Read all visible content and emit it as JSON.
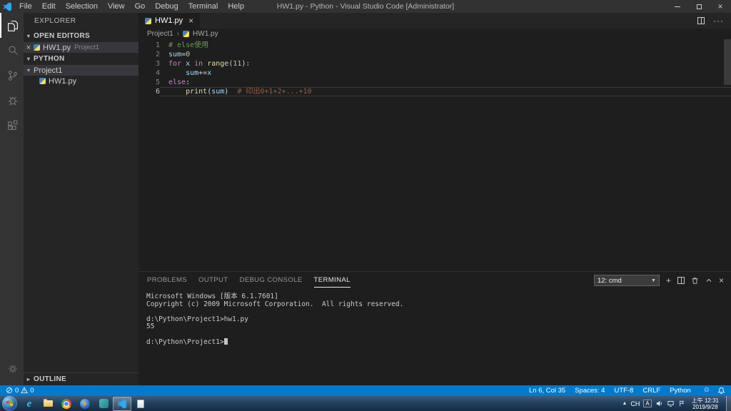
{
  "title_bar": {
    "app_title": "HW1.py - Python - Visual Studio Code [Administrator]",
    "menus": [
      "File",
      "Edit",
      "Selection",
      "View",
      "Go",
      "Debug",
      "Terminal",
      "Help"
    ]
  },
  "activity_bar": {
    "icons": [
      "files",
      "search",
      "source-control",
      "debug",
      "extensions",
      "settings-gear"
    ]
  },
  "sidebar": {
    "title": "EXPLORER",
    "open_editors": {
      "label": "OPEN EDITORS",
      "item": {
        "file": "HW1.py",
        "project": "Project1"
      }
    },
    "workspace": {
      "label": "PYTHON",
      "folder": "Project1",
      "file": "HW1.py"
    },
    "outline": {
      "label": "OUTLINE"
    }
  },
  "editor": {
    "tab": "HW1.py",
    "breadcrumb": [
      "Project1",
      "HW1.py"
    ],
    "current_line": 6,
    "lines": [
      {
        "num": "1",
        "tokens": [
          {
            "t": "# else使用",
            "c": "#6A9955"
          }
        ]
      },
      {
        "num": "2",
        "tokens": [
          {
            "t": "sum",
            "c": "#9CDCFE"
          },
          {
            "t": "=",
            "c": "#D4D4D4"
          },
          {
            "t": "0",
            "c": "#B5CEA8"
          }
        ]
      },
      {
        "num": "3",
        "tokens": [
          {
            "t": "for ",
            "c": "#C586C0"
          },
          {
            "t": "x ",
            "c": "#9CDCFE"
          },
          {
            "t": "in ",
            "c": "#C586C0"
          },
          {
            "t": "range",
            "c": "#DCDCAA"
          },
          {
            "t": "(",
            "c": "#D4D4D4"
          },
          {
            "t": "11",
            "c": "#B5CEA8"
          },
          {
            "t": "):",
            "c": "#D4D4D4"
          }
        ]
      },
      {
        "num": "4",
        "tokens": [
          {
            "t": "    sum",
            "c": "#9CDCFE"
          },
          {
            "t": "+=",
            "c": "#D4D4D4"
          },
          {
            "t": "x",
            "c": "#9CDCFE"
          }
        ]
      },
      {
        "num": "5",
        "tokens": [
          {
            "t": "else",
            "c": "#C586C0"
          },
          {
            "t": ":",
            "c": "#D4D4D4"
          }
        ]
      },
      {
        "num": "6",
        "current": true,
        "tokens": [
          {
            "t": "    print",
            "c": "#DCDCAA"
          },
          {
            "t": "(",
            "c": "#D4D4D4"
          },
          {
            "t": "sum",
            "c": "#9CDCFE"
          },
          {
            "t": ")  ",
            "c": "#D4D4D4"
          },
          {
            "t": "# 印出0+1+2+...+10",
            "c": "#9C5B4B"
          }
        ]
      }
    ]
  },
  "panel": {
    "tabs": [
      {
        "label": "PROBLEMS"
      },
      {
        "label": "OUTPUT"
      },
      {
        "label": "DEBUG CONSOLE"
      },
      {
        "label": "TERMINAL",
        "active": true
      }
    ],
    "terminal": {
      "selector": "12: cmd",
      "lines": [
        "Microsoft Windows [版本 6.1.7601]",
        "Copyright (c) 2009 Microsoft Corporation.  All rights reserved.",
        "",
        "d:\\Python\\Project1>hw1.py",
        "55",
        ""
      ],
      "prompt": "d:\\Python\\Project1>"
    }
  },
  "status_bar": {
    "errors": "0",
    "warnings": "0",
    "items": [
      "Ln 6, Col 35",
      "Spaces: 4",
      "UTF-8",
      "CRLF",
      "Python"
    ]
  },
  "taskbar": {
    "tray": {
      "lang": "CH",
      "ime": "A",
      "time": "上午 12:31",
      "date": "2019/9/28"
    }
  }
}
